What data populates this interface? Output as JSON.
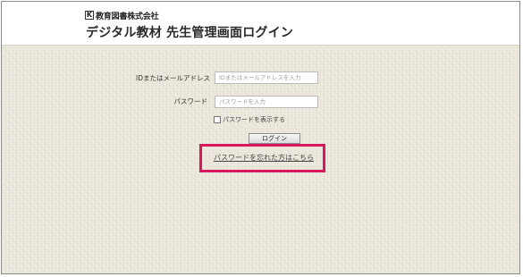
{
  "header": {
    "logo_mark": "K",
    "logo_text": "教育図書株式会社",
    "title": "デジタル教材 先生管理画面ログイン"
  },
  "login_form": {
    "id_label": "IDまたはメールアドレス",
    "id_placeholder": "IDまたはメールアドレスを入力",
    "id_value": "",
    "password_label": "パスワード",
    "password_placeholder": "パスワードを入力",
    "password_value": "",
    "show_password_label": "パスワードを表示する",
    "show_password_checked": false,
    "login_button": "ログイン",
    "forgot_password_link": "パスワードを忘れた方はこちら"
  },
  "colors": {
    "highlight": "#d8175e",
    "background": "#ece8dd"
  }
}
